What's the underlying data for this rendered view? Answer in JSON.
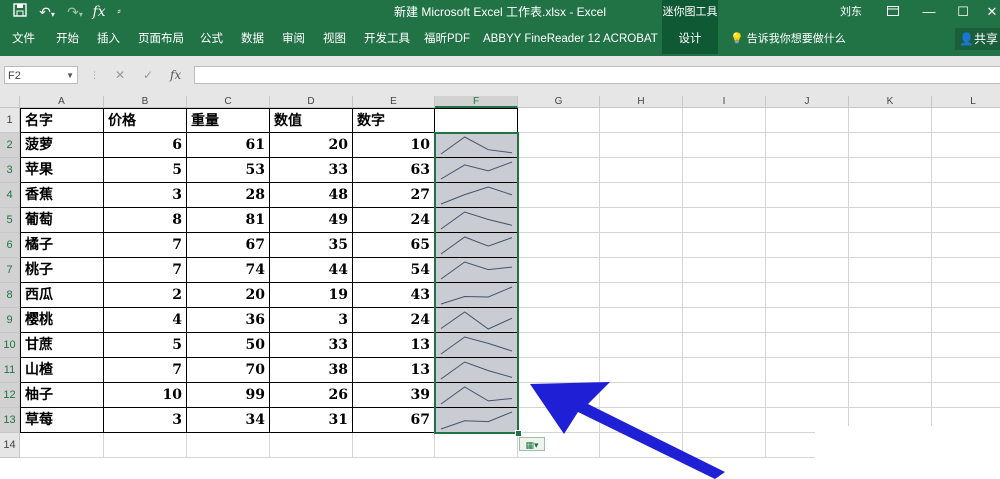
{
  "title_bar": {
    "title": "新建 Microsoft Excel 工作表.xlsx  -  Excel",
    "context_group": "迷你图工具",
    "user": "刘东",
    "save_icon": "save-icon",
    "undo_icon": "undo-icon",
    "redo_icon": "redo-icon",
    "fx_label": "fx",
    "customize_icon": "customize-icon"
  },
  "ribbon": {
    "tabs": [
      "文件",
      "开始",
      "插入",
      "页面布局",
      "公式",
      "数据",
      "审阅",
      "视图",
      "开发工具",
      "福昕PDF",
      "ABBYY FineReader 12",
      "ACROBAT"
    ],
    "design_tab": "设计",
    "tell_me": "告诉我你想要做什么",
    "share": "共享"
  },
  "formula_bar": {
    "name_box": "F2",
    "cancel_icon": "cancel-icon",
    "enter_icon": "enter-icon",
    "fx_label": "fx",
    "formula": ""
  },
  "columns": [
    "A",
    "B",
    "C",
    "D",
    "E",
    "F",
    "G",
    "H",
    "I",
    "J",
    "K",
    "L"
  ],
  "selected_column": "F",
  "rows": [
    "1",
    "2",
    "3",
    "4",
    "5",
    "6",
    "7",
    "8",
    "9",
    "10",
    "11",
    "12",
    "13",
    "14"
  ],
  "table": {
    "headers": [
      "名字",
      "价格",
      "重量",
      "数值",
      "数字"
    ],
    "data": [
      [
        "菠萝",
        6,
        61,
        20,
        10
      ],
      [
        "苹果",
        5,
        53,
        33,
        63
      ],
      [
        "香蕉",
        3,
        28,
        48,
        27
      ],
      [
        "葡萄",
        8,
        81,
        49,
        24
      ],
      [
        "橘子",
        7,
        67,
        35,
        65
      ],
      [
        "桃子",
        7,
        74,
        44,
        54
      ],
      [
        "西瓜",
        2,
        20,
        19,
        43
      ],
      [
        "樱桃",
        4,
        36,
        3,
        24
      ],
      [
        "甘蔗",
        5,
        50,
        33,
        13
      ],
      [
        "山楂",
        7,
        70,
        38,
        13
      ],
      [
        "柚子",
        10,
        99,
        26,
        39
      ],
      [
        "草莓",
        3,
        34,
        31,
        67
      ]
    ]
  },
  "sparkline_color": "#44546a",
  "selection_color": "#217346",
  "arrow_color": "#1f1fd6",
  "quick_analysis_icon": "quick-analysis-icon"
}
